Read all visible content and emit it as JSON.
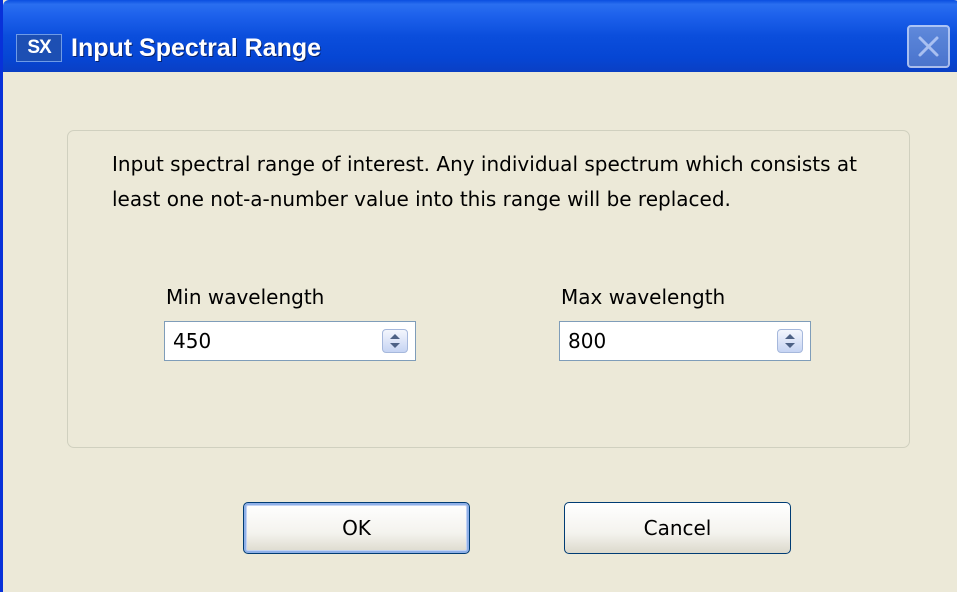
{
  "window": {
    "app_icon_text": "SX",
    "title": "Input Spectral Range"
  },
  "dialog": {
    "description": "Input spectral range of interest. Any individual spectrum which consists at least one not-a-number value into this range will be replaced.",
    "min_label": "Min wavelength",
    "min_value": "450",
    "max_label": "Max wavelength",
    "max_value": "800"
  },
  "buttons": {
    "ok_label": "OK",
    "cancel_label": "Cancel"
  },
  "icons": {
    "app": "sx-app-icon",
    "close": "close-icon",
    "spin": "spin-arrows-icon"
  },
  "colors": {
    "titlebar": "#0b4edc",
    "dialog_background": "#ece9d8",
    "button_border": "#003c74"
  }
}
